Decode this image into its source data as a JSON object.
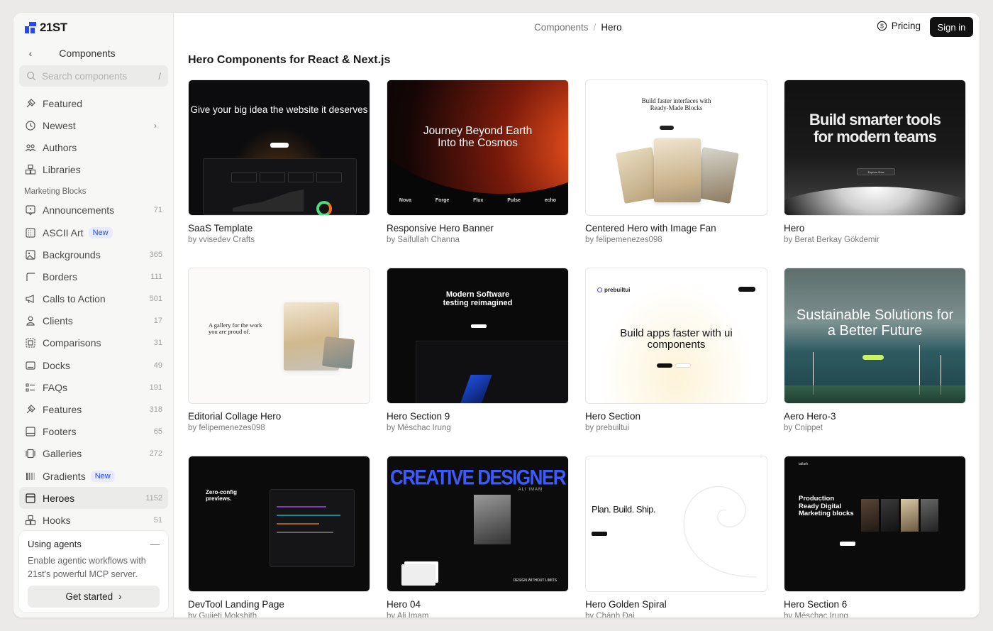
{
  "brand": {
    "name": "21ST"
  },
  "sidebar": {
    "back_title": "Components",
    "search_placeholder": "Search components",
    "search_shortcut": "/",
    "top_items": [
      {
        "label": "Featured",
        "icon": "featured-icon"
      },
      {
        "label": "Newest",
        "icon": "clock-icon"
      },
      {
        "label": "Authors",
        "icon": "authors-icon"
      },
      {
        "label": "Libraries",
        "icon": "libraries-icon"
      }
    ],
    "section_label": "Marketing Blocks",
    "items": [
      {
        "label": "Announcements",
        "count": "71"
      },
      {
        "label": "ASCII Art",
        "badge": "New"
      },
      {
        "label": "Backgrounds",
        "count": "365"
      },
      {
        "label": "Borders",
        "count": "111"
      },
      {
        "label": "Calls to Action",
        "count": "501"
      },
      {
        "label": "Clients",
        "count": "17"
      },
      {
        "label": "Comparisons",
        "count": "31"
      },
      {
        "label": "Docks",
        "count": "49"
      },
      {
        "label": "FAQs",
        "count": "191"
      },
      {
        "label": "Features",
        "count": "318"
      },
      {
        "label": "Footers",
        "count": "65"
      },
      {
        "label": "Galleries",
        "count": "272"
      },
      {
        "label": "Gradients",
        "badge": "New"
      },
      {
        "label": "Heroes",
        "count": "1152"
      },
      {
        "label": "Hooks",
        "count": "51"
      }
    ],
    "promo": {
      "title": "Using agents",
      "description": "Enable agentic workflows with 21st's powerful MCP server.",
      "button": "Get started"
    }
  },
  "header": {
    "breadcrumb_parent": "Components",
    "breadcrumb_sep": "/",
    "breadcrumb_current": "Hero",
    "pricing": "Pricing",
    "signin": "Sign in"
  },
  "page_title": "Hero Components for React & Next.js",
  "cards": [
    {
      "title": "SaaS Template",
      "author": "by vvisedev Crafts",
      "headline": "Give your big idea the website it deserves"
    },
    {
      "title": "Responsive Hero Banner",
      "author": "by Saifullah Channa",
      "headline": "Journey Beyond Earth Into the Cosmos"
    },
    {
      "title": "Centered Hero with Image Fan",
      "author": "by felipemenezes098",
      "headline": "Build faster interfaces with Ready-Made Blocks"
    },
    {
      "title": "Hero",
      "author": "by Berat Berkay Gökdemir",
      "headline": "Build smarter tools for modern teams"
    },
    {
      "title": "Editorial Collage Hero",
      "author": "by felipemenezes098",
      "headline": "A gallery for the work you are proud of."
    },
    {
      "title": "Hero Section 9",
      "author": "by Méschac Irung",
      "headline": "Modern Software testing reimagined"
    },
    {
      "title": "Hero Section",
      "author": "by prebuiltui",
      "headline": "Build apps faster with ui components"
    },
    {
      "title": "Aero Hero-3",
      "author": "by Cnippet",
      "headline": "Sustainable Solutions for a Better Future"
    },
    {
      "title": "DevTool Landing Page",
      "author": "by Gujjeti Mokshith",
      "headline": "Zero-config previews."
    },
    {
      "title": "Hero 04",
      "author": "by Ali Imam",
      "headline": "CREATIVE DESIGNER"
    },
    {
      "title": "Hero Golden Spiral",
      "author": "by Chánh Đại",
      "headline": "Plan. Build. Ship."
    },
    {
      "title": "Hero Section 6",
      "author": "by Méschac Irung",
      "headline": "Production Ready Digital Marketing blocks"
    }
  ],
  "thumb_text": {
    "saas_cta": "Get started",
    "cosmos_logos": [
      "Nova",
      "Forge",
      "Flux",
      "Pulse",
      "echo"
    ],
    "centered_sub": "Get Started",
    "smarter_cta": "Explore Now",
    "prebuilt_brand": "prebuiltui",
    "ali_sub": "ALI IMAM",
    "ali_tag": "DESIGN WITHOUT LIMITS",
    "tailark": "tailark"
  },
  "colors": {
    "accent": "#2447ff",
    "signin_bg": "#111111"
  }
}
